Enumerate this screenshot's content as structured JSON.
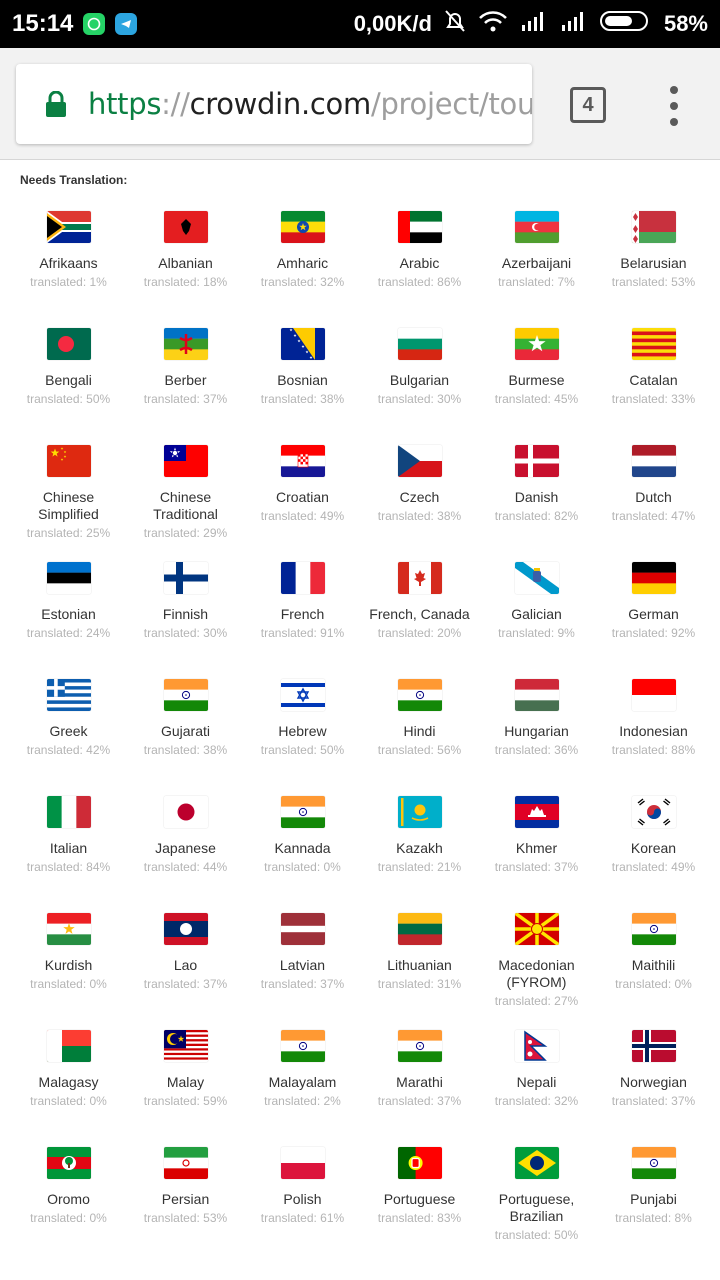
{
  "status_bar": {
    "time": "15:14",
    "net_speed": "0,00K/d",
    "battery": "58%"
  },
  "browser": {
    "url_scheme": "https",
    "url_sep": "://",
    "url_host": "crowdin.com",
    "url_path": "/project/touch",
    "tab_count": "4"
  },
  "section_heading": "Needs Translation:",
  "languages": [
    {
      "name": "Afrikaans",
      "progress": "translated: 1%",
      "flag": "za"
    },
    {
      "name": "Albanian",
      "progress": "translated: 18%",
      "flag": "al"
    },
    {
      "name": "Amharic",
      "progress": "translated: 32%",
      "flag": "et"
    },
    {
      "name": "Arabic",
      "progress": "translated: 86%",
      "flag": "ae"
    },
    {
      "name": "Azerbaijani",
      "progress": "translated: 7%",
      "flag": "az"
    },
    {
      "name": "Belarusian",
      "progress": "translated: 53%",
      "flag": "by"
    },
    {
      "name": "Bengali",
      "progress": "translated: 50%",
      "flag": "bd"
    },
    {
      "name": "Berber",
      "progress": "translated: 37%",
      "flag": "berber"
    },
    {
      "name": "Bosnian",
      "progress": "translated: 38%",
      "flag": "ba"
    },
    {
      "name": "Bulgarian",
      "progress": "translated: 30%",
      "flag": "bg"
    },
    {
      "name": "Burmese",
      "progress": "translated: 45%",
      "flag": "mm"
    },
    {
      "name": "Catalan",
      "progress": "translated: 33%",
      "flag": "cat"
    },
    {
      "name": "Chinese Simplified",
      "progress": "translated: 25%",
      "flag": "cn"
    },
    {
      "name": "Chinese Traditional",
      "progress": "translated: 29%",
      "flag": "tw"
    },
    {
      "name": "Croatian",
      "progress": "translated: 49%",
      "flag": "hr"
    },
    {
      "name": "Czech",
      "progress": "translated: 38%",
      "flag": "cz"
    },
    {
      "name": "Danish",
      "progress": "translated: 82%",
      "flag": "dk"
    },
    {
      "name": "Dutch",
      "progress": "translated: 47%",
      "flag": "nl"
    },
    {
      "name": "Estonian",
      "progress": "translated: 24%",
      "flag": "ee"
    },
    {
      "name": "Finnish",
      "progress": "translated: 30%",
      "flag": "fi"
    },
    {
      "name": "French",
      "progress": "translated: 91%",
      "flag": "fr"
    },
    {
      "name": "French, Canada",
      "progress": "translated: 20%",
      "flag": "ca"
    },
    {
      "name": "Galician",
      "progress": "translated: 9%",
      "flag": "gal"
    },
    {
      "name": "German",
      "progress": "translated: 92%",
      "flag": "de"
    },
    {
      "name": "Greek",
      "progress": "translated: 42%",
      "flag": "gr"
    },
    {
      "name": "Gujarati",
      "progress": "translated: 38%",
      "flag": "in"
    },
    {
      "name": "Hebrew",
      "progress": "translated: 50%",
      "flag": "il"
    },
    {
      "name": "Hindi",
      "progress": "translated: 56%",
      "flag": "in"
    },
    {
      "name": "Hungarian",
      "progress": "translated: 36%",
      "flag": "hu"
    },
    {
      "name": "Indonesian",
      "progress": "translated: 88%",
      "flag": "id"
    },
    {
      "name": "Italian",
      "progress": "translated: 84%",
      "flag": "it"
    },
    {
      "name": "Japanese",
      "progress": "translated: 44%",
      "flag": "jp"
    },
    {
      "name": "Kannada",
      "progress": "translated: 0%",
      "flag": "in"
    },
    {
      "name": "Kazakh",
      "progress": "translated: 21%",
      "flag": "kz"
    },
    {
      "name": "Khmer",
      "progress": "translated: 37%",
      "flag": "kh"
    },
    {
      "name": "Korean",
      "progress": "translated: 49%",
      "flag": "kr"
    },
    {
      "name": "Kurdish",
      "progress": "translated: 0%",
      "flag": "kurd"
    },
    {
      "name": "Lao",
      "progress": "translated: 37%",
      "flag": "la"
    },
    {
      "name": "Latvian",
      "progress": "translated: 37%",
      "flag": "lv"
    },
    {
      "name": "Lithuanian",
      "progress": "translated: 31%",
      "flag": "lt"
    },
    {
      "name": "Macedonian (FYROM)",
      "progress": "translated: 27%",
      "flag": "mk"
    },
    {
      "name": "Maithili",
      "progress": "translated: 0%",
      "flag": "in"
    },
    {
      "name": "Malagasy",
      "progress": "translated: 0%",
      "flag": "mg"
    },
    {
      "name": "Malay",
      "progress": "translated: 59%",
      "flag": "my"
    },
    {
      "name": "Malayalam",
      "progress": "translated: 2%",
      "flag": "in"
    },
    {
      "name": "Marathi",
      "progress": "translated: 37%",
      "flag": "in"
    },
    {
      "name": "Nepali",
      "progress": "translated: 32%",
      "flag": "np"
    },
    {
      "name": "Norwegian",
      "progress": "translated: 37%",
      "flag": "no"
    },
    {
      "name": "Oromo",
      "progress": "translated: 0%",
      "flag": "oromo"
    },
    {
      "name": "Persian",
      "progress": "translated: 53%",
      "flag": "ir"
    },
    {
      "name": "Polish",
      "progress": "translated: 61%",
      "flag": "pl"
    },
    {
      "name": "Portuguese",
      "progress": "translated: 83%",
      "flag": "pt"
    },
    {
      "name": "Portuguese, Brazilian",
      "progress": "translated: 50%",
      "flag": "br"
    },
    {
      "name": "Punjabi",
      "progress": "translated: 8%",
      "flag": "in"
    }
  ]
}
